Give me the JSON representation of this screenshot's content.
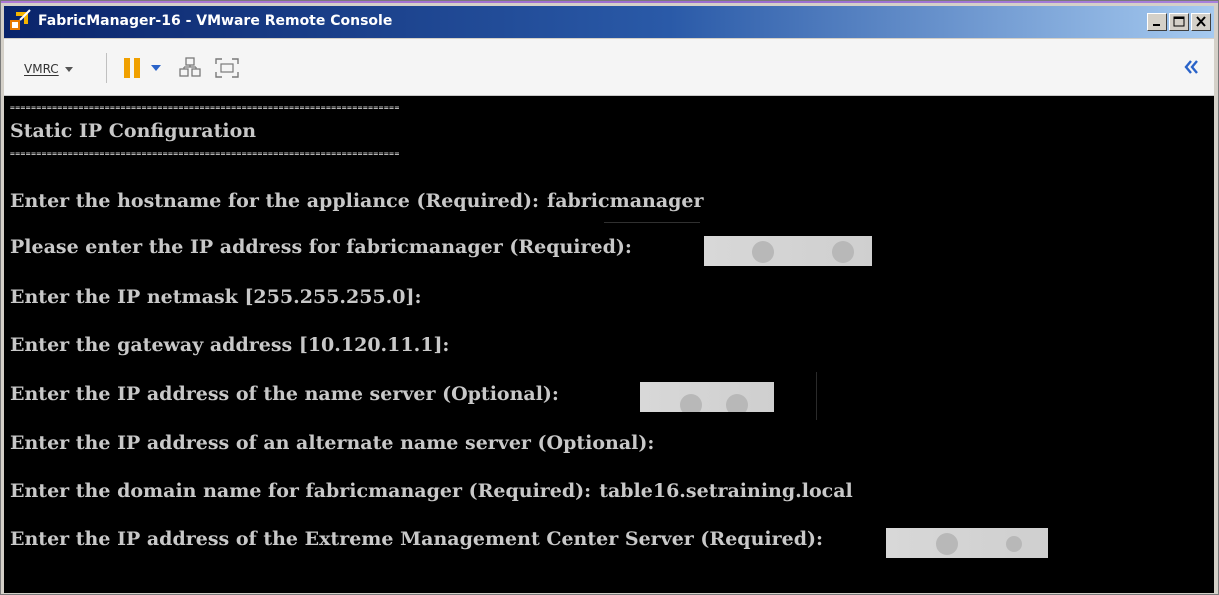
{
  "window": {
    "title": "FabricManager-16 - VMware Remote Console",
    "icon": "vmware-remote-console-icon",
    "controls": [
      "minimize",
      "maximize",
      "close"
    ]
  },
  "toolbar": {
    "menu_label": "VMRC",
    "tools": [
      "pause-icon",
      "power-dropdown-icon",
      "send-ctrl-alt-del-icon",
      "fullscreen-icon"
    ],
    "collapse_icon": "double-chevron-left-icon",
    "accent_color": "#f0a000"
  },
  "console": {
    "separator": "==========================================================================",
    "heading": "Static IP Configuration",
    "lines": [
      {
        "prompt": "Enter the hostname for the appliance (Required):",
        "value": "fabricmanager"
      },
      {
        "prompt": "Please enter the IP address for fabricmanager (Required):",
        "value": ""
      },
      {
        "prompt": "Enter the IP netmask [255.255.255.0]:",
        "value": ""
      },
      {
        "prompt": "Enter the gateway address [10.120.11.1]:",
        "value": ""
      },
      {
        "prompt": "Enter the IP address of the name server (Optional):",
        "value": ""
      },
      {
        "prompt": "Enter the IP address of an alternate name server (Optional):",
        "value": ""
      },
      {
        "prompt": "Enter the domain name for fabricmanager (Required):",
        "value": "table16.setraining.local"
      },
      {
        "prompt": "Enter the IP address of the Extreme Management Center Server (Required):",
        "value": ""
      }
    ],
    "text_color": "#c8c8c8",
    "background_color": "#000000"
  }
}
